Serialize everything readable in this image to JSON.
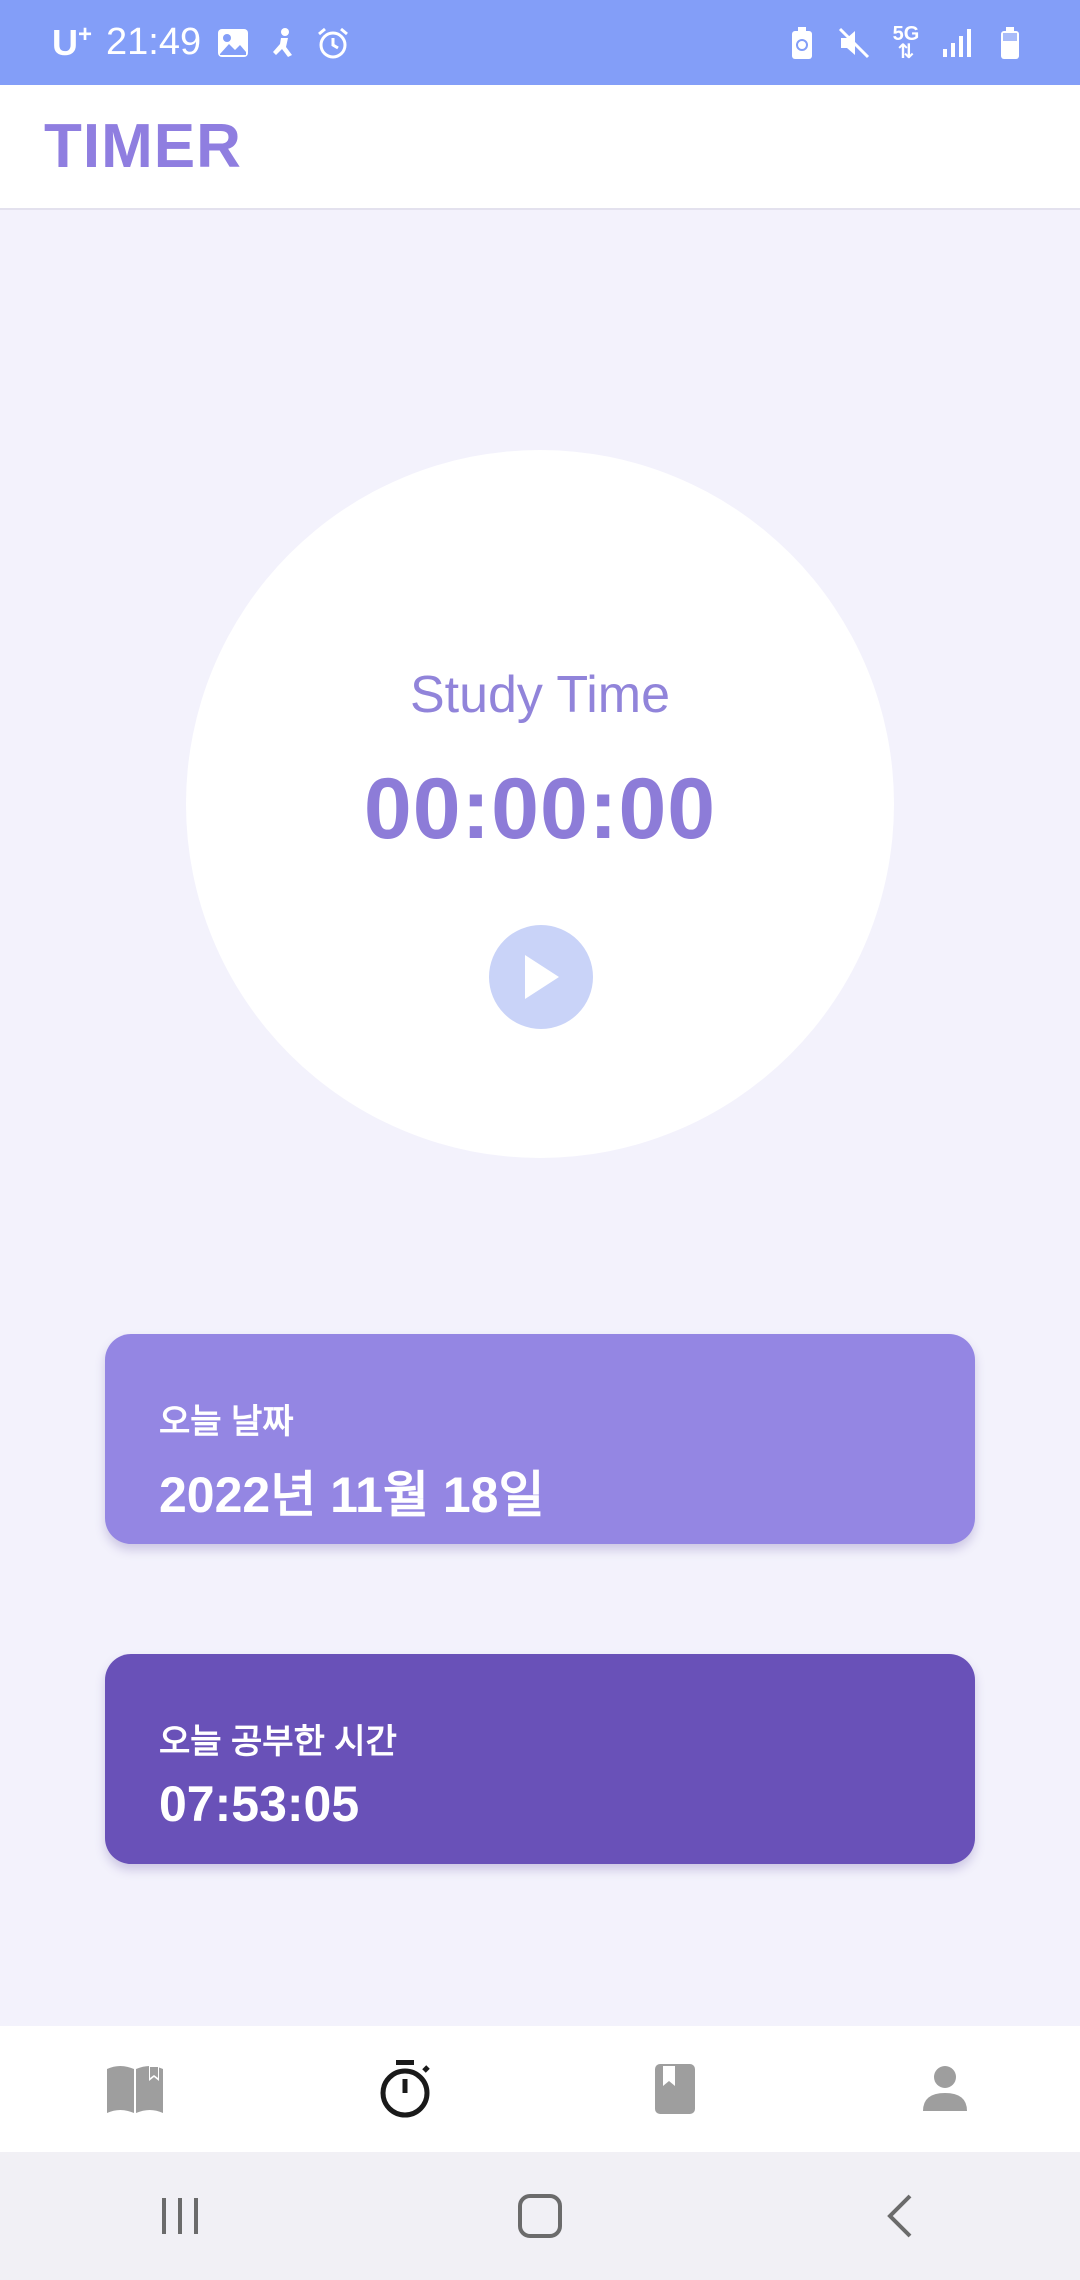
{
  "status_bar": {
    "carrier": "U",
    "carrier_sup": "+",
    "time": "21:49",
    "network": "5G"
  },
  "app_bar": {
    "title": "TIMER"
  },
  "timer": {
    "label": "Study Time",
    "value": "00:00:00",
    "play_icon": "play-icon"
  },
  "cards": {
    "date": {
      "label": "오늘 날짜",
      "value": "2022년 11월 18일"
    },
    "study_time": {
      "label": "오늘 공부한 시간",
      "value": "07:53:05"
    }
  },
  "bottom_nav": {
    "items": [
      "book-open-icon",
      "stopwatch-icon",
      "bookmark-book-icon",
      "person-icon"
    ],
    "active_index": 1
  },
  "colors": {
    "status_bar": "#839ef8",
    "title": "#8f7ee0",
    "timer_text": "#8d7cd8",
    "play_button": "#c9d3f8",
    "date_card": "#9486e3",
    "study_card": "#6951b8",
    "nav_inactive": "#9e9e9e",
    "nav_active": "#1a1a1a"
  }
}
